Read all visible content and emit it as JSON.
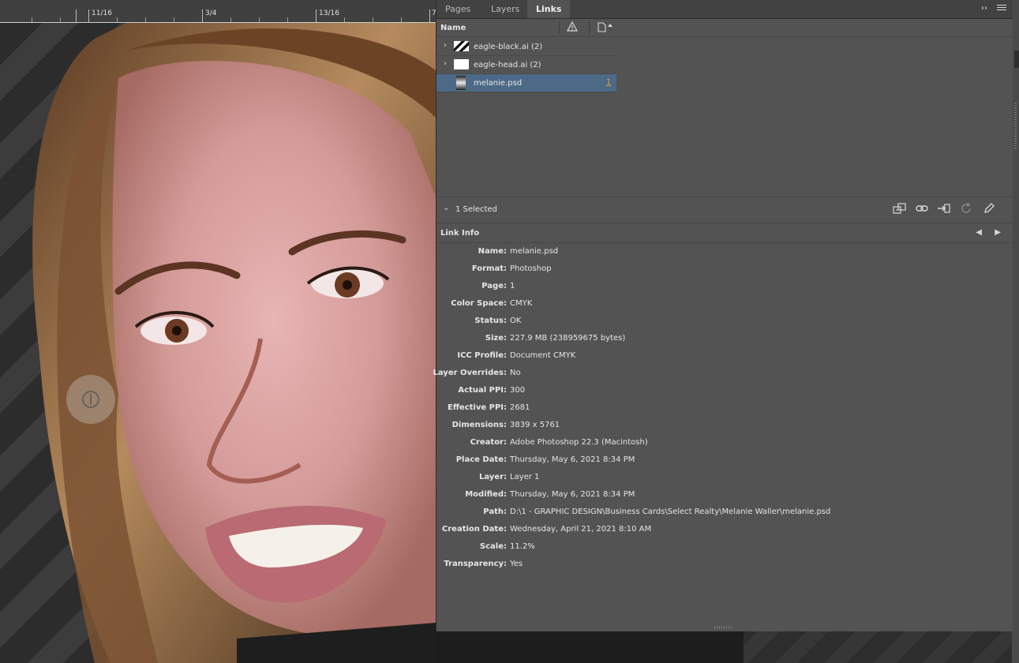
{
  "ruler": {
    "labels": [
      "11/16",
      "3/4",
      "13/16",
      "7"
    ]
  },
  "tabs": [
    {
      "label": "Pages"
    },
    {
      "label": "Layers"
    },
    {
      "label": "Links"
    }
  ],
  "tab_controls": {
    "collapse": "››"
  },
  "links_panel": {
    "column_name": "Name",
    "links": [
      {
        "name": "eagle-black.ai (2)",
        "page": "",
        "thumb": "eagle-black-thumb"
      },
      {
        "name": "eagle-head.ai (2)",
        "page": "",
        "thumb": "eagle-head-thumb"
      },
      {
        "name": "melanie.psd",
        "page": "1",
        "thumb": "photo-thumb"
      }
    ],
    "selected_count_label": "1 Selected"
  },
  "link_info": {
    "title": "Link Info",
    "fields": [
      {
        "key": "Name:",
        "value": "melanie.psd"
      },
      {
        "key": "Format:",
        "value": "Photoshop"
      },
      {
        "key": "Page:",
        "value": "1"
      },
      {
        "key": "Color Space:",
        "value": "CMYK"
      },
      {
        "key": "Status:",
        "value": "OK"
      },
      {
        "key": "Size:",
        "value": "227.9 MB (238959675 bytes)"
      },
      {
        "key": "ICC Profile:",
        "value": "Document CMYK"
      },
      {
        "key": "Layer Overrides:",
        "value": "No"
      },
      {
        "key": "Actual PPI:",
        "value": "300"
      },
      {
        "key": "Effective PPI:",
        "value": "2681"
      },
      {
        "key": "Dimensions:",
        "value": "3839 x 5761"
      },
      {
        "key": "Creator:",
        "value": "Adobe Photoshop 22.3 (Macintosh)"
      },
      {
        "key": "Place Date:",
        "value": "Thursday, May 6, 2021 8:34 PM"
      },
      {
        "key": "Layer:",
        "value": "Layer 1"
      },
      {
        "key": "Modified:",
        "value": "Thursday, May 6, 2021 8:34 PM"
      },
      {
        "key": "Path:",
        "value": "D:\\1 - GRAPHIC DESIGN\\Business Cards\\Select Realty\\Melanie Waller\\melanie.psd"
      },
      {
        "key": "Creation Date:",
        "value": "Wednesday, April 21, 2021 8:10 AM"
      },
      {
        "key": "Scale:",
        "value": "11.2%"
      },
      {
        "key": "Transparency:",
        "value": "Yes"
      }
    ]
  },
  "icons": {
    "status_column": "warning-icon",
    "page_column": "page-icon",
    "toolbar": [
      "relink-to-folder-icon",
      "go-to-link-icon",
      "update-link-icon",
      "refresh-icon",
      "edit-original-icon"
    ]
  },
  "colors": {
    "panel_bg": "#535353",
    "selected_row": "#4c6a87",
    "page_link": "#e0a030"
  }
}
